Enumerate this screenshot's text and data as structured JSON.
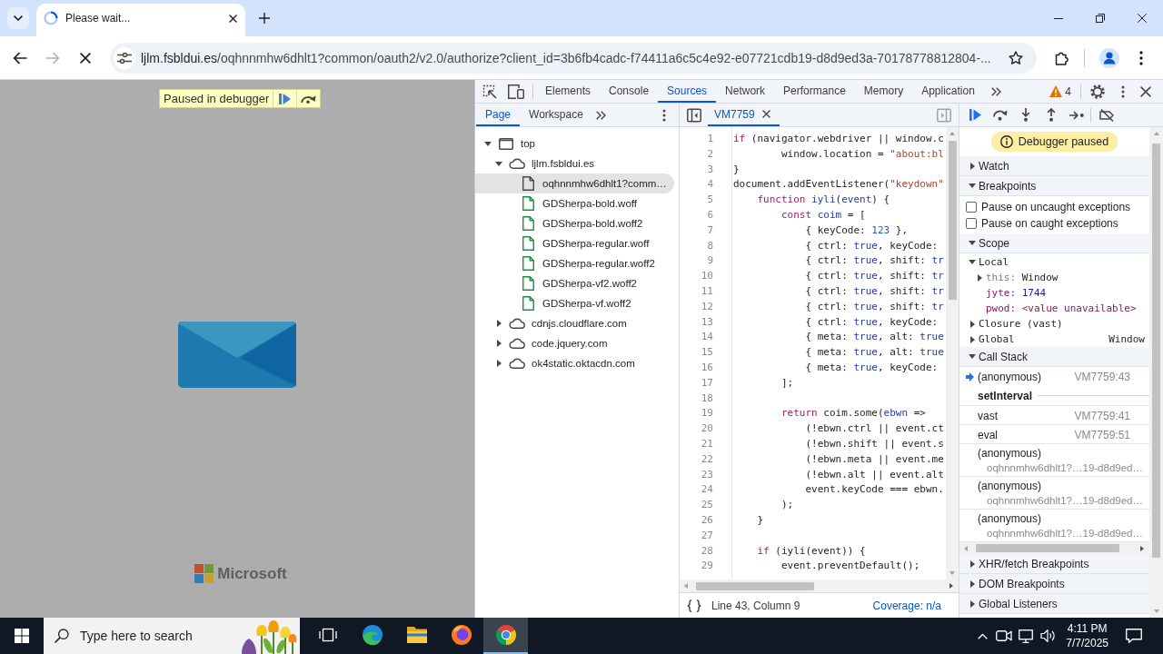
{
  "browser": {
    "tabs": [
      {
        "title": "Please wait...",
        "selected": true,
        "loading": true
      }
    ],
    "nav_buttons": [
      {
        "kind": "back",
        "disabled": false
      },
      {
        "kind": "forward",
        "disabled": true
      },
      {
        "kind": "stop",
        "disabled": false
      }
    ],
    "address": {
      "host": "ljlm.fsbldui.es",
      "path": "/oqhnnmhw6dhlt1?common/oauth2/v2.0/authorize?client_id=3b6fb4cadc-f74411a6c5c4e92-e07721cdb19-d8d9ed3a-70178778812804-..."
    }
  },
  "page": {
    "banner": "Paused in debugger",
    "logo_text": "Microsoft"
  },
  "devtools": {
    "tabs": [
      {
        "label": "Elements",
        "selected": false
      },
      {
        "label": "Console",
        "selected": false
      },
      {
        "label": "Sources",
        "selected": true
      },
      {
        "label": "Network",
        "selected": false
      },
      {
        "label": "Performance",
        "selected": false
      },
      {
        "label": "Memory",
        "selected": false
      },
      {
        "label": "Application",
        "selected": false
      }
    ],
    "warning_count": "4",
    "navigator": {
      "tabs": [
        {
          "label": "Page",
          "selected": true
        },
        {
          "label": "Workspace",
          "selected": false
        }
      ],
      "tree": [
        {
          "kind": "frame",
          "label": "top",
          "expanded": true,
          "selected": false,
          "children": [
            {
              "kind": "domain",
              "label": "ljlm.fsbldui.es",
              "expanded": true,
              "selected": false,
              "children": [
                {
                  "kind": "document",
                  "label": "oqhnnmhw6dhlt1?comm…",
                  "selected": true
                },
                {
                  "kind": "font",
                  "label": "GDSherpa-bold.woff",
                  "selected": false
                },
                {
                  "kind": "font",
                  "label": "GDSherpa-bold.woff2",
                  "selected": false
                },
                {
                  "kind": "font",
                  "label": "GDSherpa-regular.woff",
                  "selected": false
                },
                {
                  "kind": "font",
                  "label": "GDSherpa-regular.woff2",
                  "selected": false
                },
                {
                  "kind": "font",
                  "label": "GDSherpa-vf2.woff2",
                  "selected": false
                },
                {
                  "kind": "font",
                  "label": "GDSherpa-vf.woff2",
                  "selected": false
                }
              ]
            },
            {
              "kind": "domain",
              "label": "cdnjs.cloudflare.com",
              "expanded": false,
              "selected": false
            },
            {
              "kind": "domain",
              "label": "code.jquery.com",
              "expanded": false,
              "selected": false
            },
            {
              "kind": "domain",
              "label": "ok4static.oktacdn.com",
              "expanded": false,
              "selected": false
            }
          ]
        }
      ]
    },
    "editor": {
      "tabs": [
        {
          "label": "VM7759",
          "selected": true
        }
      ],
      "lines": [
        {
          "number": "1",
          "tokens": [
            {
              "kind": "keyword",
              "text": "if"
            },
            {
              "kind": "plain",
              "text": " (navigator.webdriver || window.c"
            }
          ]
        },
        {
          "number": "2",
          "tokens": [
            {
              "kind": "plain",
              "text": "        window.location = "
            },
            {
              "kind": "string",
              "text": "\"about:bl"
            }
          ]
        },
        {
          "number": "3",
          "tokens": [
            {
              "kind": "plain",
              "text": "}"
            }
          ]
        },
        {
          "number": "4",
          "tokens": [
            {
              "kind": "plain",
              "text": "document.addEventListener("
            },
            {
              "kind": "string",
              "text": "\"keydown\""
            }
          ]
        },
        {
          "number": "5",
          "tokens": [
            {
              "kind": "keyword",
              "text": "    function"
            },
            {
              "kind": "def",
              "text": " iyli"
            },
            {
              "kind": "plain",
              "text": "("
            },
            {
              "kind": "def",
              "text": "event"
            },
            {
              "kind": "plain",
              "text": ") {"
            }
          ]
        },
        {
          "number": "6",
          "tokens": [
            {
              "kind": "keyword",
              "text": "        const"
            },
            {
              "kind": "def",
              "text": " coim"
            },
            {
              "kind": "plain",
              "text": " = ["
            }
          ]
        },
        {
          "number": "7",
          "tokens": [
            {
              "kind": "plain",
              "text": "            { keyCode: "
            },
            {
              "kind": "number",
              "text": "123"
            },
            {
              "kind": "plain",
              "text": " },"
            }
          ]
        },
        {
          "number": "8",
          "tokens": [
            {
              "kind": "plain",
              "text": "            { ctrl: "
            },
            {
              "kind": "atom",
              "text": "true"
            },
            {
              "kind": "plain",
              "text": ", keyCode:"
            }
          ]
        },
        {
          "number": "9",
          "tokens": [
            {
              "kind": "plain",
              "text": "            { ctrl: "
            },
            {
              "kind": "atom",
              "text": "true"
            },
            {
              "kind": "plain",
              "text": ", shift: "
            },
            {
              "kind": "atom",
              "text": "tr"
            }
          ]
        },
        {
          "number": "10",
          "tokens": [
            {
              "kind": "plain",
              "text": "            { ctrl: "
            },
            {
              "kind": "atom",
              "text": "true"
            },
            {
              "kind": "plain",
              "text": ", shift: "
            },
            {
              "kind": "atom",
              "text": "tr"
            }
          ]
        },
        {
          "number": "11",
          "tokens": [
            {
              "kind": "plain",
              "text": "            { ctrl: "
            },
            {
              "kind": "atom",
              "text": "true"
            },
            {
              "kind": "plain",
              "text": ", shift: "
            },
            {
              "kind": "atom",
              "text": "tr"
            }
          ]
        },
        {
          "number": "12",
          "tokens": [
            {
              "kind": "plain",
              "text": "            { ctrl: "
            },
            {
              "kind": "atom",
              "text": "true"
            },
            {
              "kind": "plain",
              "text": ", shift: "
            },
            {
              "kind": "atom",
              "text": "tr"
            }
          ]
        },
        {
          "number": "13",
          "tokens": [
            {
              "kind": "plain",
              "text": "            { ctrl: "
            },
            {
              "kind": "atom",
              "text": "true"
            },
            {
              "kind": "plain",
              "text": ", keyCode:"
            }
          ]
        },
        {
          "number": "14",
          "tokens": [
            {
              "kind": "plain",
              "text": "            { meta: "
            },
            {
              "kind": "atom",
              "text": "true"
            },
            {
              "kind": "plain",
              "text": ", alt: "
            },
            {
              "kind": "atom",
              "text": "true"
            }
          ]
        },
        {
          "number": "15",
          "tokens": [
            {
              "kind": "plain",
              "text": "            { meta: "
            },
            {
              "kind": "atom",
              "text": "true"
            },
            {
              "kind": "plain",
              "text": ", alt: "
            },
            {
              "kind": "atom",
              "text": "true"
            }
          ]
        },
        {
          "number": "16",
          "tokens": [
            {
              "kind": "plain",
              "text": "            { meta: "
            },
            {
              "kind": "atom",
              "text": "true"
            },
            {
              "kind": "plain",
              "text": ", keyCode:"
            }
          ]
        },
        {
          "number": "17",
          "tokens": [
            {
              "kind": "plain",
              "text": "        ];"
            }
          ]
        },
        {
          "number": "18"
        },
        {
          "number": "19",
          "tokens": [
            {
              "kind": "keyword",
              "text": "        return"
            },
            {
              "kind": "plain",
              "text": " coim.some("
            },
            {
              "kind": "def",
              "text": "ebwn"
            },
            {
              "kind": "plain",
              "text": " =>"
            }
          ]
        },
        {
          "number": "20",
          "tokens": [
            {
              "kind": "plain",
              "text": "            (!ebwn.ctrl || event.ct"
            }
          ]
        },
        {
          "number": "21",
          "tokens": [
            {
              "kind": "plain",
              "text": "            (!ebwn.shift || event.s"
            }
          ]
        },
        {
          "number": "22",
          "tokens": [
            {
              "kind": "plain",
              "text": "            (!ebwn.meta || event.me"
            }
          ]
        },
        {
          "number": "23",
          "tokens": [
            {
              "kind": "plain",
              "text": "            (!ebwn.alt || event.alt"
            }
          ]
        },
        {
          "number": "24",
          "tokens": [
            {
              "kind": "plain",
              "text": "            event.keyCode === ebwn."
            }
          ]
        },
        {
          "number": "25",
          "tokens": [
            {
              "kind": "plain",
              "text": "        );"
            }
          ]
        },
        {
          "number": "26",
          "tokens": [
            {
              "kind": "plain",
              "text": "    }"
            }
          ]
        },
        {
          "number": "27"
        },
        {
          "number": "28",
          "tokens": [
            {
              "kind": "keyword",
              "text": "    if"
            },
            {
              "kind": "plain",
              "text": " (iyli(event)) {"
            }
          ]
        },
        {
          "number": "29",
          "tokens": [
            {
              "kind": "plain",
              "text": "        event.preventDefault();"
            }
          ]
        }
      ],
      "cursor": "Line 43, Column 9",
      "coverage": "Coverage: n/a"
    },
    "sidebar": {
      "status": "Debugger paused",
      "sections": [
        {
          "title": "Watch",
          "expanded": false
        },
        {
          "title": "Breakpoints",
          "expanded": true,
          "options": [
            {
              "label": "Pause on uncaught exceptions",
              "checked": false
            },
            {
              "label": "Pause on caught exceptions",
              "checked": false
            }
          ]
        },
        {
          "title": "Scope",
          "expanded": true,
          "tree": [
            {
              "kind": "scope",
              "name": "Local",
              "expanded": true,
              "children": [
                {
                  "kind": "object",
                  "name": "this:",
                  "value": "Window",
                  "expanded": false
                },
                {
                  "kind": "number",
                  "name": "jyte:",
                  "value": "1744"
                },
                {
                  "kind": "unavailable",
                  "name": "pwod:",
                  "value": "<value unavailable>"
                }
              ]
            },
            {
              "kind": "scope",
              "name": "Closure (vast)",
              "expanded": false
            },
            {
              "kind": "global",
              "name": "Global",
              "value": "Window",
              "expanded": false
            }
          ]
        },
        {
          "title": "Call Stack",
          "expanded": true,
          "frames": [
            {
              "kind": "frame",
              "name": "(anonymous)",
              "location": "VM7759:43",
              "selected": true
            },
            {
              "kind": "async",
              "name": "setInterval"
            },
            {
              "kind": "frame",
              "name": "vast",
              "location": "VM7759:41",
              "selected": false
            },
            {
              "kind": "frame",
              "name": "eval",
              "location": "VM7759:51",
              "selected": false
            },
            {
              "kind": "frame",
              "name": "(anonymous)",
              "url": "oqhnnmhw6dhlt1?…19-d8d9ed…",
              "selected": false
            },
            {
              "kind": "frame",
              "name": "(anonymous)",
              "url": "oqhnnmhw6dhlt1?…19-d8d9ed…",
              "selected": false
            },
            {
              "kind": "frame",
              "name": "(anonymous)",
              "url": "oqhnnmhw6dhlt1?…19-d8d9ed…",
              "selected": false
            }
          ]
        },
        {
          "title": "XHR/fetch Breakpoints",
          "expanded": false
        },
        {
          "title": "DOM Breakpoints",
          "expanded": false
        },
        {
          "title": "Global Listeners",
          "expanded": false
        }
      ]
    }
  },
  "taskbar": {
    "search": {
      "placeholder": "Type here to search"
    },
    "apps": [
      {
        "kind": "task_view",
        "active": false
      },
      {
        "kind": "edge",
        "active": false
      },
      {
        "kind": "explorer",
        "active": false
      },
      {
        "kind": "firefox",
        "active": false
      },
      {
        "kind": "chrome",
        "active": true
      }
    ],
    "time": "4:11 PM",
    "date": "7/7/2025"
  }
}
